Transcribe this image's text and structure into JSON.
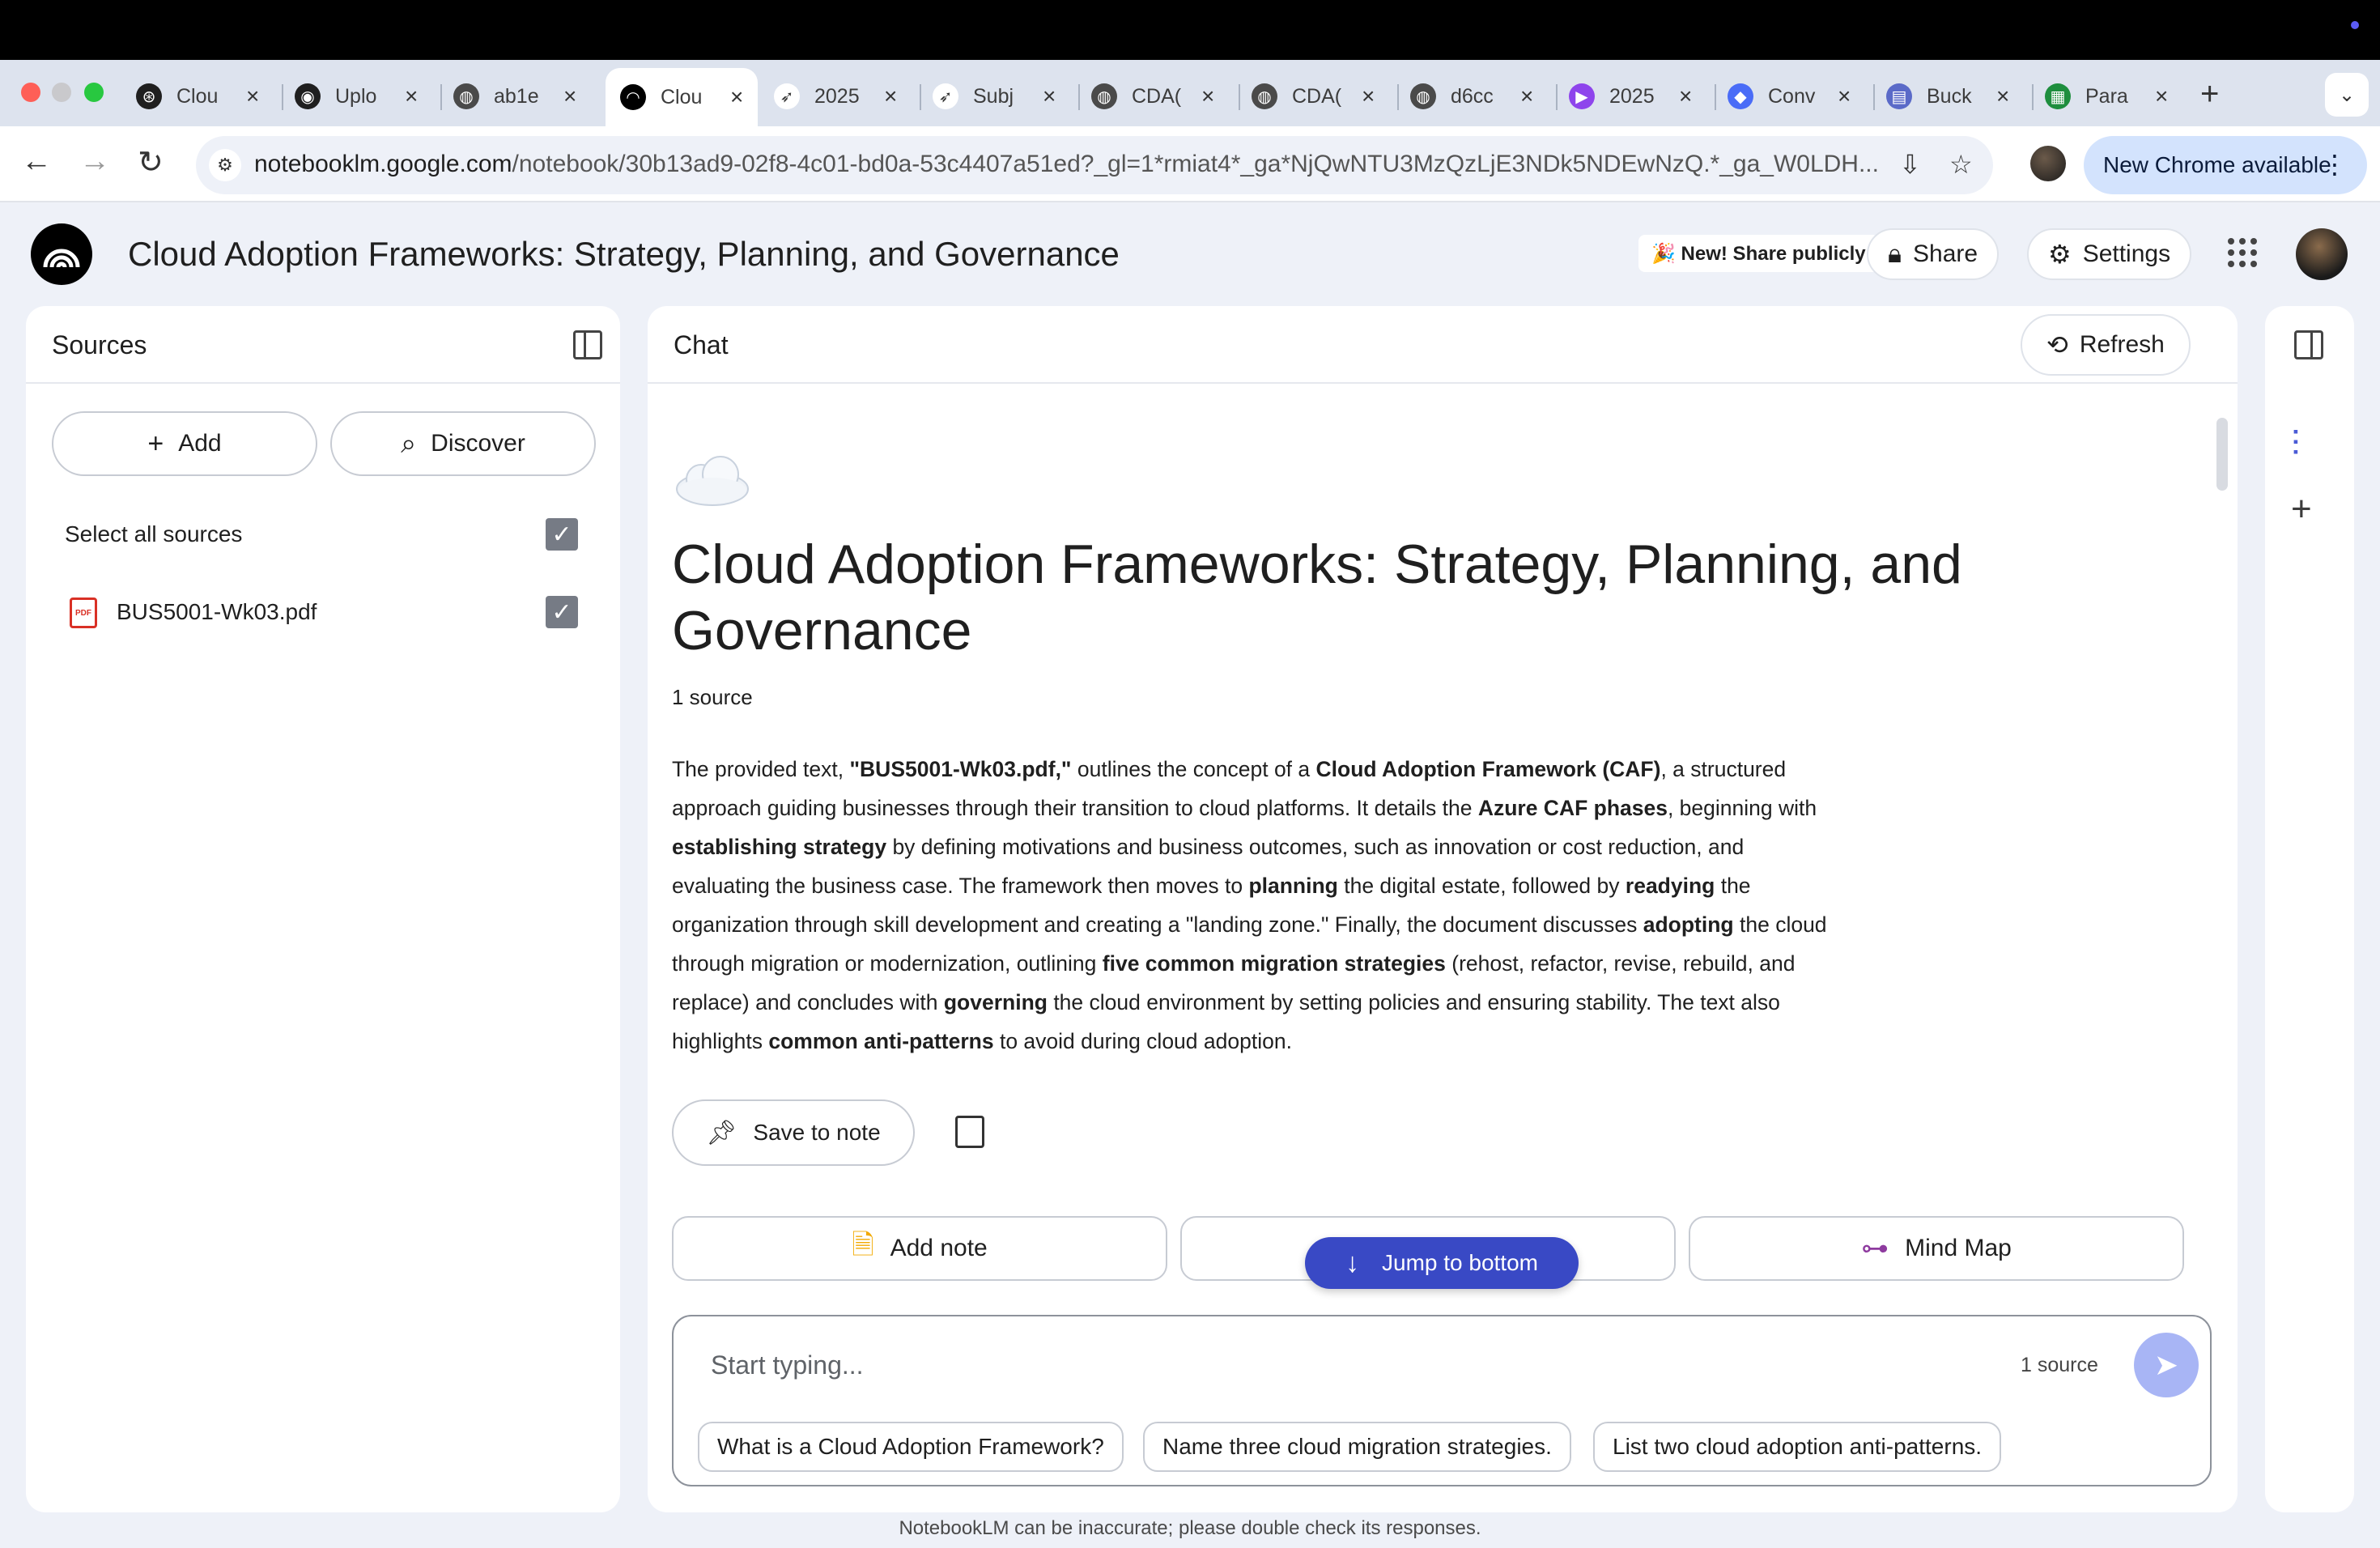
{
  "browser": {
    "tabs": [
      {
        "title": "Clou",
        "icon": "openai-icon",
        "color": "#1f1f1f"
      },
      {
        "title": "Uplo",
        "icon": "github-icon",
        "color": "#1f1f1f"
      },
      {
        "title": "ab1e",
        "icon": "globe-icon",
        "color": "#4a4a4a"
      },
      {
        "title": "Clou",
        "icon": "notebooklm-icon",
        "color": "#000000",
        "active": true
      },
      {
        "title": "2025",
        "icon": "bird-icon",
        "color": "#ffffff"
      },
      {
        "title": "Subj",
        "icon": "bird-icon",
        "color": "#ffffff"
      },
      {
        "title": "CDA(",
        "icon": "globe-icon",
        "color": "#4a4a4a"
      },
      {
        "title": "CDA(",
        "icon": "globe-icon",
        "color": "#4a4a4a"
      },
      {
        "title": "d6cc",
        "icon": "globe-icon",
        "color": "#4a4a4a"
      },
      {
        "title": "2025",
        "icon": "video-icon",
        "color": "#8e44ec"
      },
      {
        "title": "Conv",
        "icon": "cube-icon",
        "color": "#4a6cf7"
      },
      {
        "title": "Buck",
        "icon": "bucket-icon",
        "color": "#5a6ac8"
      },
      {
        "title": "Para",
        "icon": "sheet-icon",
        "color": "#1e8e3e"
      }
    ],
    "url_host": "notebooklm.google.com",
    "url_path": "/notebook/30b13ad9-02f8-4c01-bd0a-53c4407a51ed?_gl=1*rmiat4*_ga*NjQwNTU3MzQzLjE3NDk5NDEwNzQ.*_ga_W0LDH...",
    "update_label": "New Chrome available"
  },
  "header": {
    "title": "Cloud Adoption Frameworks: Strategy, Planning, and Governance",
    "share_publicly": "🎉 New! Share publicly",
    "share_label": "Share",
    "settings_label": "Settings"
  },
  "sources": {
    "title": "Sources",
    "add_label": "Add",
    "discover_label": "Discover",
    "select_all_label": "Select all sources",
    "items": [
      {
        "name": "BUS5001-Wk03.pdf",
        "checked": true
      }
    ]
  },
  "chat": {
    "title": "Chat",
    "refresh_label": "Refresh",
    "notebook_title": "Cloud Adoption Frameworks: Strategy, Planning, and Governance",
    "source_count": "1 source",
    "summary_segments": [
      {
        "t": "The provided text, ",
        "b": false
      },
      {
        "t": "\"BUS5001-Wk03.pdf,\"",
        "b": true
      },
      {
        "t": " outlines the concept of a ",
        "b": false
      },
      {
        "t": "Cloud Adoption Framework (CAF)",
        "b": true
      },
      {
        "t": ", a structured approach guiding businesses through their transition to cloud platforms. It details the ",
        "b": false
      },
      {
        "t": "Azure CAF phases",
        "b": true
      },
      {
        "t": ", beginning with ",
        "b": false
      },
      {
        "t": "establishing strategy",
        "b": true
      },
      {
        "t": " by defining motivations and business outcomes, such as innovation or cost reduction, and evaluating the business case. The framework then moves to ",
        "b": false
      },
      {
        "t": "planning",
        "b": true
      },
      {
        "t": " the digital estate, followed by ",
        "b": false
      },
      {
        "t": "readying",
        "b": true
      },
      {
        "t": " the organization through skill development and creating a \"landing zone.\" Finally, the document discusses ",
        "b": false
      },
      {
        "t": "adopting",
        "b": true
      },
      {
        "t": " the cloud through migration or modernization, outlining ",
        "b": false
      },
      {
        "t": "five common migration strategies",
        "b": true
      },
      {
        "t": " (rehost, refactor, revise, rebuild, and replace) and concludes with ",
        "b": false
      },
      {
        "t": "governing",
        "b": true
      },
      {
        "t": " the cloud environment by setting policies and ensuring stability. The text also highlights ",
        "b": false
      },
      {
        "t": "common anti-patterns",
        "b": true
      },
      {
        "t": " to avoid during cloud adoption.",
        "b": false
      }
    ],
    "save_to_note": "Save to note",
    "add_note": "Add note",
    "mind_map": "Mind Map",
    "jump_to_bottom": "Jump to bottom",
    "input_placeholder": "Start typing...",
    "input_source_count": "1 source",
    "suggestions": [
      "What is a Cloud Adoption Framework?",
      "Name three cloud migration strategies.",
      "List two cloud adoption anti-patterns."
    ]
  },
  "footer": {
    "disclaimer": "NotebookLM can be inaccurate; please double check its responses."
  },
  "colors": {
    "accent": "#3949c5",
    "background": "#eef1f8",
    "send_button": "#a8b5f5"
  }
}
